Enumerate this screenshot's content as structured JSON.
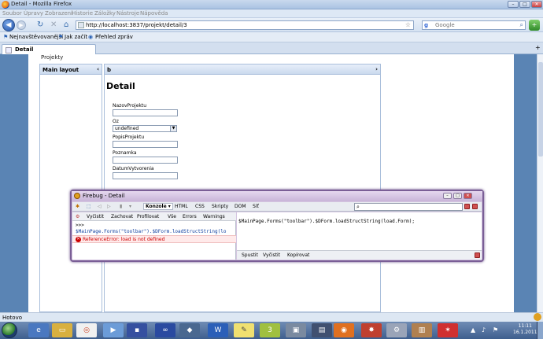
{
  "window": {
    "title": "Detail - Mozilla Firefox",
    "controls": [
      "–",
      "□",
      "✕"
    ]
  },
  "menu": [
    "Soubor",
    "Úpravy",
    "Zobrazení",
    "Historie",
    "Záložky",
    "Nástroje",
    "Nápověda"
  ],
  "nav": {
    "url": "http://localhost:3837/projekt/detail/3",
    "search_placeholder": "Google"
  },
  "bookmarks": [
    "Nejnavštěvovanější",
    "Jak začít",
    "Přehled zpráv"
  ],
  "tab": {
    "label": "Detail"
  },
  "page": {
    "section": "Projekty",
    "left_panel_title": "Main layout",
    "main_panel_title": "b",
    "detail_title": "Detail",
    "fields": {
      "name_label": "NazovProjektu",
      "oz_label": "Oz",
      "oz_value": "undefined",
      "desc_label": "PopisProjektu",
      "note_label": "Poznamka",
      "date_label": "DatumVytvorenia"
    }
  },
  "firebug": {
    "title": "Firebug - Detail",
    "tabs": [
      "Konzole ▾",
      "HTML",
      "CSS",
      "Skripty",
      "DOM",
      "Síť"
    ],
    "subtoolbar": [
      "Vyčistit",
      "Zachovat",
      "Profilovat",
      "Vše",
      "Errors",
      "Warnings"
    ],
    "log_prompt": ">>>",
    "log_command": "$MainPage.Forms(\"toolbar\").$DForm.loadStructString(lo",
    "log_error": "ReferenceError: load is not defined",
    "editor_text": "$MainPage.Forms(\"toolbar\").$DForm.loadStructString(load.Form);",
    "buttons": [
      "Spustit",
      "Vyčistit",
      "Kopírovat"
    ]
  },
  "status": "Hotovo",
  "clock": {
    "time": "11:11",
    "date": "16.1.2011"
  },
  "colors": {
    "page_bg": "#5a84b4",
    "firebug_border": "#7a5e96",
    "error": "#cc0000"
  }
}
